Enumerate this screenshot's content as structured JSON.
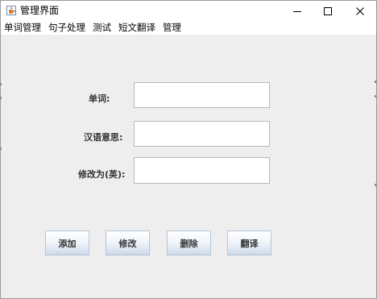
{
  "window": {
    "title": "管理界面",
    "icon": "java-cup-icon"
  },
  "controls": {
    "minimize_icon": "minimize-icon",
    "maximize_icon": "maximize-icon",
    "close_icon": "close-icon"
  },
  "menu": {
    "items": [
      {
        "label": "单词管理"
      },
      {
        "label": "句子处理"
      },
      {
        "label": "测试"
      },
      {
        "label": "短文翻译"
      },
      {
        "label": "管理"
      }
    ]
  },
  "form": {
    "word_label": "单词:",
    "word_value": "",
    "meaning_label": "汉语意思:",
    "meaning_value": "",
    "edit_label": "修改为(英):",
    "edit_value": ""
  },
  "buttons": {
    "add": "添加",
    "modify": "修改",
    "delete": "删除",
    "translate": "翻译"
  },
  "colors": {
    "window_bg": "#eeeeee",
    "titlebar_bg": "#ffffff",
    "button_gradient_bottom": "#c8d7e8",
    "label_text": "#333333"
  }
}
